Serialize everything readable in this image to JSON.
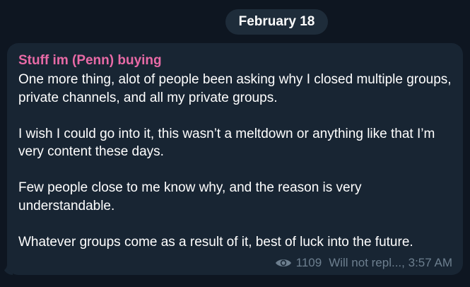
{
  "date_divider": "February 18",
  "message": {
    "sender": "Stuff im (Penn) buying",
    "paragraphs": [
      "One more thing, alot of people been asking why I closed multiple groups, private channels, and all my private groups.",
      "I wish I could go into it, this wasn’t a meltdown or anything like that I’m very content these days.",
      "Few people close to me know why, and the reason is very understandable.",
      "Whatever groups come as a result of it, best of luck into the future."
    ],
    "views": "1109",
    "signature": "Will not repl...,",
    "time": "3:57 AM",
    "view_icon": "eye-icon"
  },
  "colors": {
    "background": "#0e1621",
    "bubble": "#182533",
    "sender": "#e86aa6",
    "meta": "#6d7f8f"
  }
}
